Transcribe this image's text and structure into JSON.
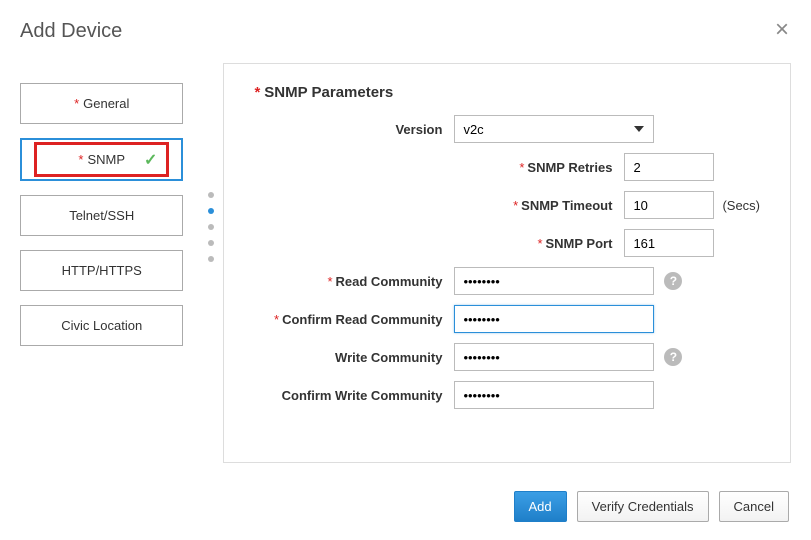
{
  "dialog": {
    "title": "Add Device"
  },
  "sidebar": {
    "items": [
      {
        "label": "General",
        "required": true
      },
      {
        "label": "SNMP",
        "required": true
      },
      {
        "label": "Telnet/SSH",
        "required": false
      },
      {
        "label": "HTTP/HTTPS",
        "required": false
      },
      {
        "label": "Civic Location",
        "required": false
      }
    ]
  },
  "section": {
    "title": "SNMP Parameters"
  },
  "form": {
    "version_label": "Version",
    "version_value": "v2c",
    "retries_label": "SNMP Retries",
    "retries_value": "2",
    "timeout_label": "SNMP Timeout",
    "timeout_value": "10",
    "timeout_suffix": "(Secs)",
    "port_label": "SNMP Port",
    "port_value": "161",
    "read_label": "Read Community",
    "read_value": "••••••••",
    "confirm_read_label": "Confirm Read Community",
    "confirm_read_value": "••••••••",
    "write_label": "Write Community",
    "write_value": "••••••••",
    "confirm_write_label": "Confirm Write Community",
    "confirm_write_value": "••••••••"
  },
  "footer": {
    "add": "Add",
    "verify": "Verify Credentials",
    "cancel": "Cancel"
  }
}
